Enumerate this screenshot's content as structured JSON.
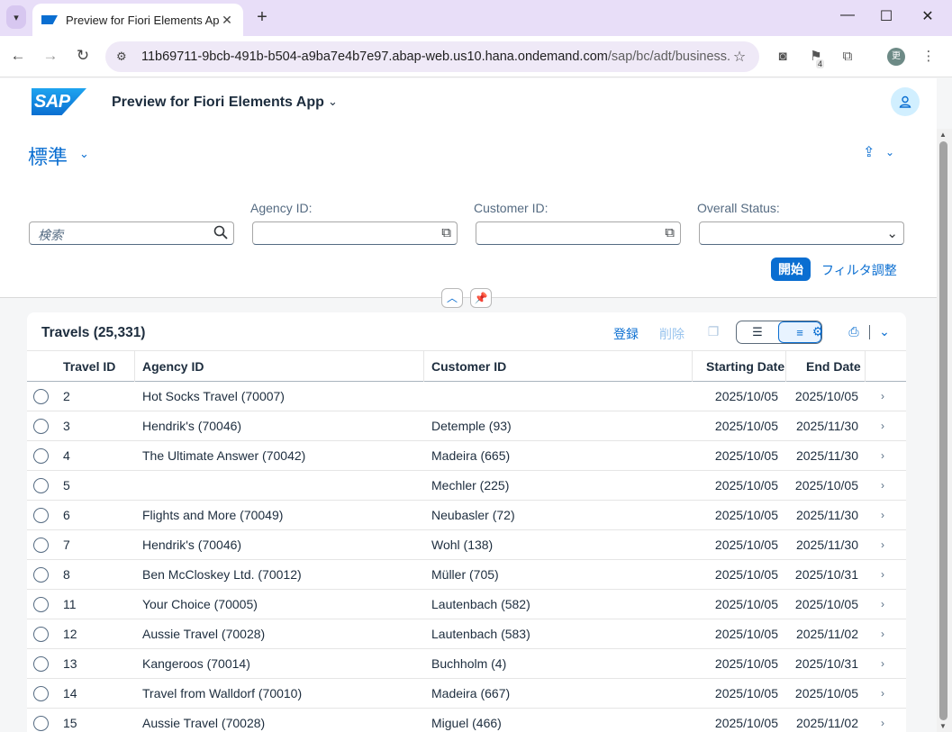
{
  "browser": {
    "tab_title": "Preview for Fiori Elements App",
    "tab_close": "✕",
    "new_tab": "+",
    "url_host": "11b69711-9bcb-491b-b504-a9ba7e4b7e97.abap-web.us10.hana.ondemand.com",
    "url_path": "/sap/bc/adt/business...",
    "extension_badge": "4",
    "profile_initial": "更"
  },
  "shell": {
    "logo_text": "SAP",
    "app_title": "Preview for Fiori Elements App"
  },
  "header": {
    "variant": "標準",
    "filters": {
      "search_placeholder": "検索",
      "agency_label": "Agency ID:",
      "customer_label": "Customer ID:",
      "status_label": "Overall Status:"
    },
    "go_label": "開始",
    "adapt_label": "フィルタ調整"
  },
  "table": {
    "title": "Travels (25,331)",
    "create_label": "登録",
    "delete_label": "削除",
    "columns": [
      "Travel ID",
      "Agency ID",
      "Customer ID",
      "Starting Date",
      "End Date"
    ],
    "rows": [
      {
        "id": "2",
        "agency": "Hot Socks Travel (70007)",
        "customer": "",
        "start": "2025/10/05",
        "end": "2025/10/05"
      },
      {
        "id": "3",
        "agency": "Hendrik's (70046)",
        "customer": "Detemple (93)",
        "start": "2025/10/05",
        "end": "2025/11/30"
      },
      {
        "id": "4",
        "agency": "The Ultimate Answer (70042)",
        "customer": "Madeira (665)",
        "start": "2025/10/05",
        "end": "2025/11/30"
      },
      {
        "id": "5",
        "agency": "",
        "customer": "Mechler (225)",
        "start": "2025/10/05",
        "end": "2025/10/05"
      },
      {
        "id": "6",
        "agency": "Flights and More (70049)",
        "customer": "Neubasler (72)",
        "start": "2025/10/05",
        "end": "2025/11/30"
      },
      {
        "id": "7",
        "agency": "Hendrik's (70046)",
        "customer": "Wohl (138)",
        "start": "2025/10/05",
        "end": "2025/11/30"
      },
      {
        "id": "8",
        "agency": "Ben McCloskey Ltd. (70012)",
        "customer": "Müller (705)",
        "start": "2025/10/05",
        "end": "2025/10/31"
      },
      {
        "id": "11",
        "agency": "Your Choice (70005)",
        "customer": "Lautenbach (582)",
        "start": "2025/10/05",
        "end": "2025/10/05"
      },
      {
        "id": "12",
        "agency": "Aussie Travel (70028)",
        "customer": "Lautenbach (583)",
        "start": "2025/10/05",
        "end": "2025/11/02"
      },
      {
        "id": "13",
        "agency": "Kangeroos (70014)",
        "customer": "Buchholm (4)",
        "start": "2025/10/05",
        "end": "2025/10/31"
      },
      {
        "id": "14",
        "agency": "Travel from Walldorf (70010)",
        "customer": "Madeira (667)",
        "start": "2025/10/05",
        "end": "2025/10/05"
      },
      {
        "id": "15",
        "agency": "Aussie Travel (70028)",
        "customer": "Miguel (466)",
        "start": "2025/10/05",
        "end": "2025/11/02"
      }
    ]
  }
}
